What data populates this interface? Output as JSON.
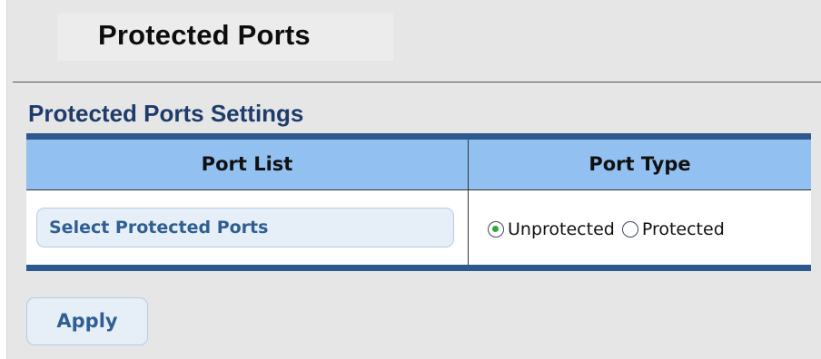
{
  "page": {
    "title": "Protected Ports"
  },
  "settings": {
    "section_title": "Protected Ports Settings",
    "columns": [
      "Port List",
      "Port Type"
    ],
    "port_list_button_label": "Select Protected Ports",
    "port_type_options": [
      {
        "label": "Unprotected",
        "selected": true
      },
      {
        "label": "Protected",
        "selected": false
      }
    ]
  },
  "actions": {
    "apply_label": "Apply"
  },
  "colors": {
    "header_bg": "#92c1f1",
    "table_border": "#2d5a8e",
    "section_title": "#1e3c6b",
    "button_text": "#2f5f92",
    "radio_selected": "#2faa3a"
  }
}
